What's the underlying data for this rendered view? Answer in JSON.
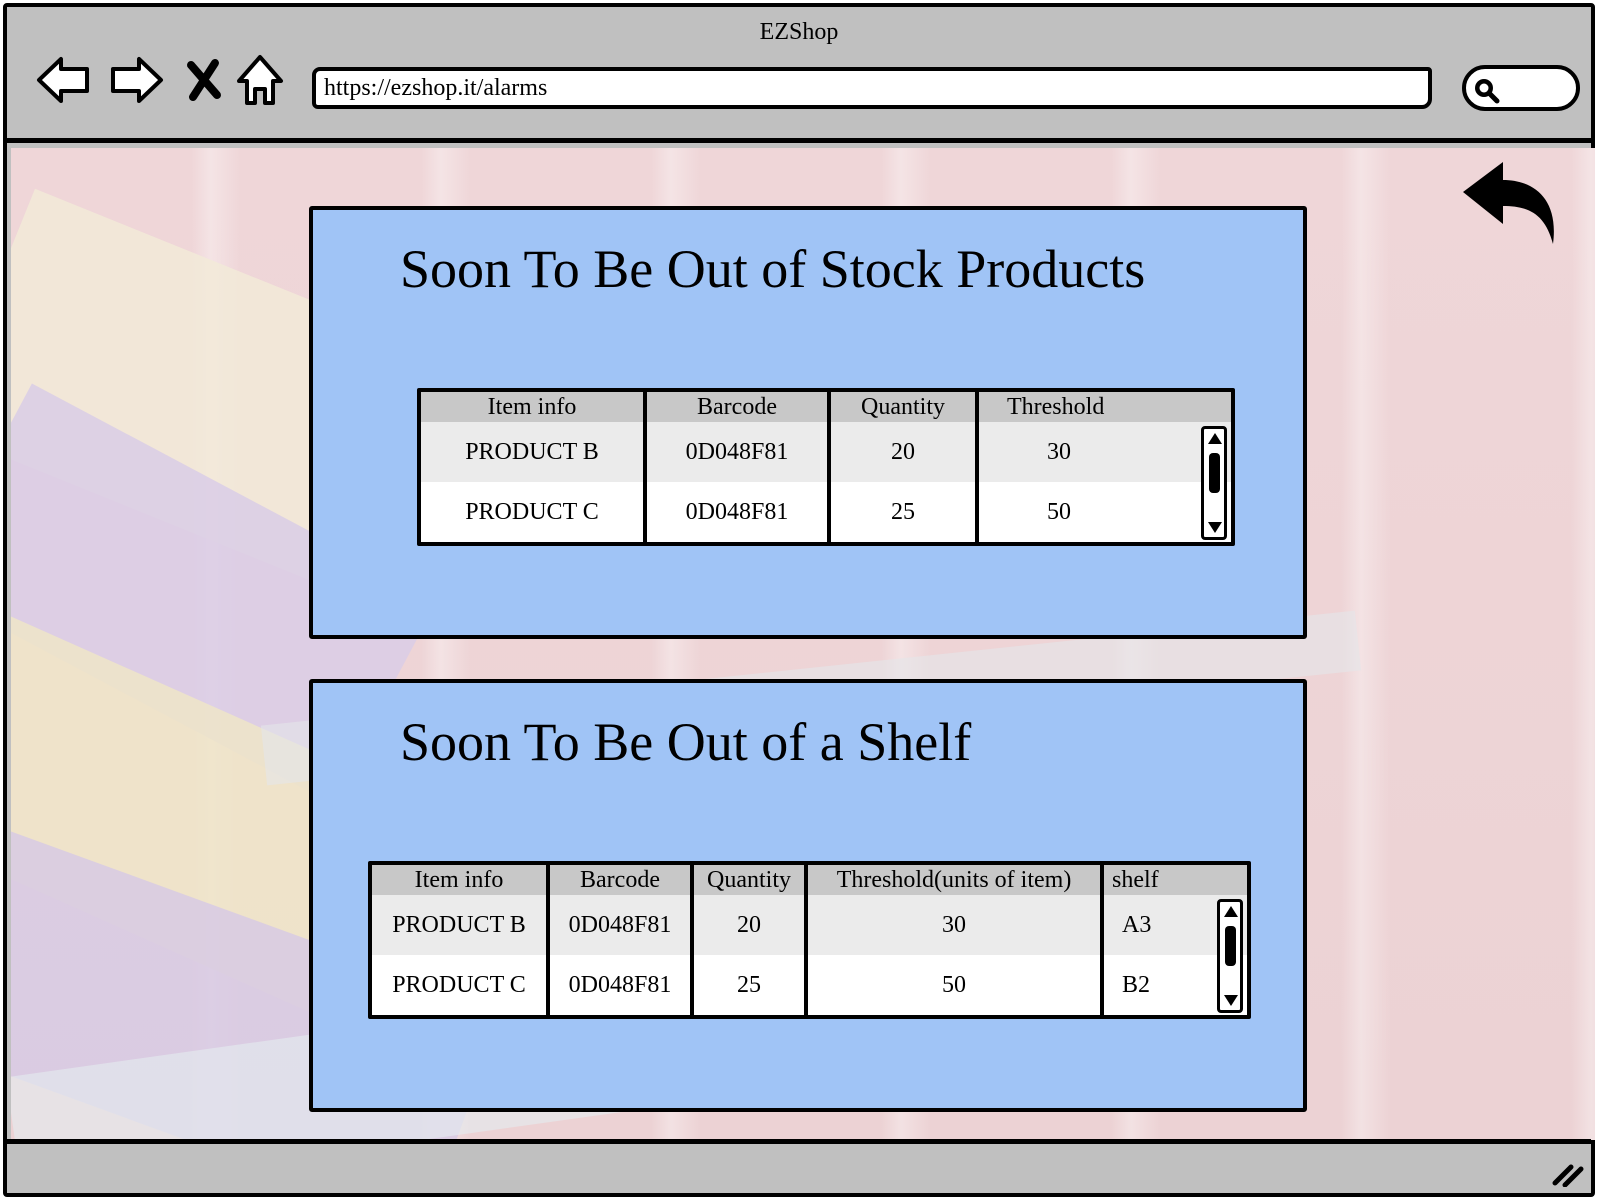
{
  "window": {
    "title": "EZShop",
    "url": "https://ezshop.it/alarms"
  },
  "icons": {
    "back": "arrow-left-icon",
    "forward": "arrow-right-icon",
    "stop": "close-icon",
    "home": "home-icon",
    "search": "search-icon",
    "page_back": "undo-arrow-icon",
    "resize": "resize-grip-icon"
  },
  "colors": {
    "panel_background": "#a0c4f6",
    "chrome_gray": "#c0c0c0",
    "table_header": "#c8c8c8",
    "row_alt": "#ebebeb"
  },
  "stock_panel": {
    "title": "Soon To Be Out of Stock Products",
    "columns": [
      "Item info",
      "Barcode",
      "Quantity",
      "Threshold"
    ],
    "rows": [
      [
        "PRODUCT B",
        "0D048F81",
        "20",
        "30"
      ],
      [
        "PRODUCT C",
        "0D048F81",
        "25",
        "50"
      ]
    ]
  },
  "shelf_panel": {
    "title": "Soon To Be Out of a Shelf",
    "columns": [
      "Item info",
      "Barcode",
      "Quantity",
      "Threshold(units of item)",
      "shelf"
    ],
    "rows": [
      [
        "PRODUCT B",
        "0D048F81",
        "20",
        "30",
        "A3"
      ],
      [
        "PRODUCT C",
        "0D048F81",
        "25",
        "50",
        "B2"
      ]
    ]
  }
}
